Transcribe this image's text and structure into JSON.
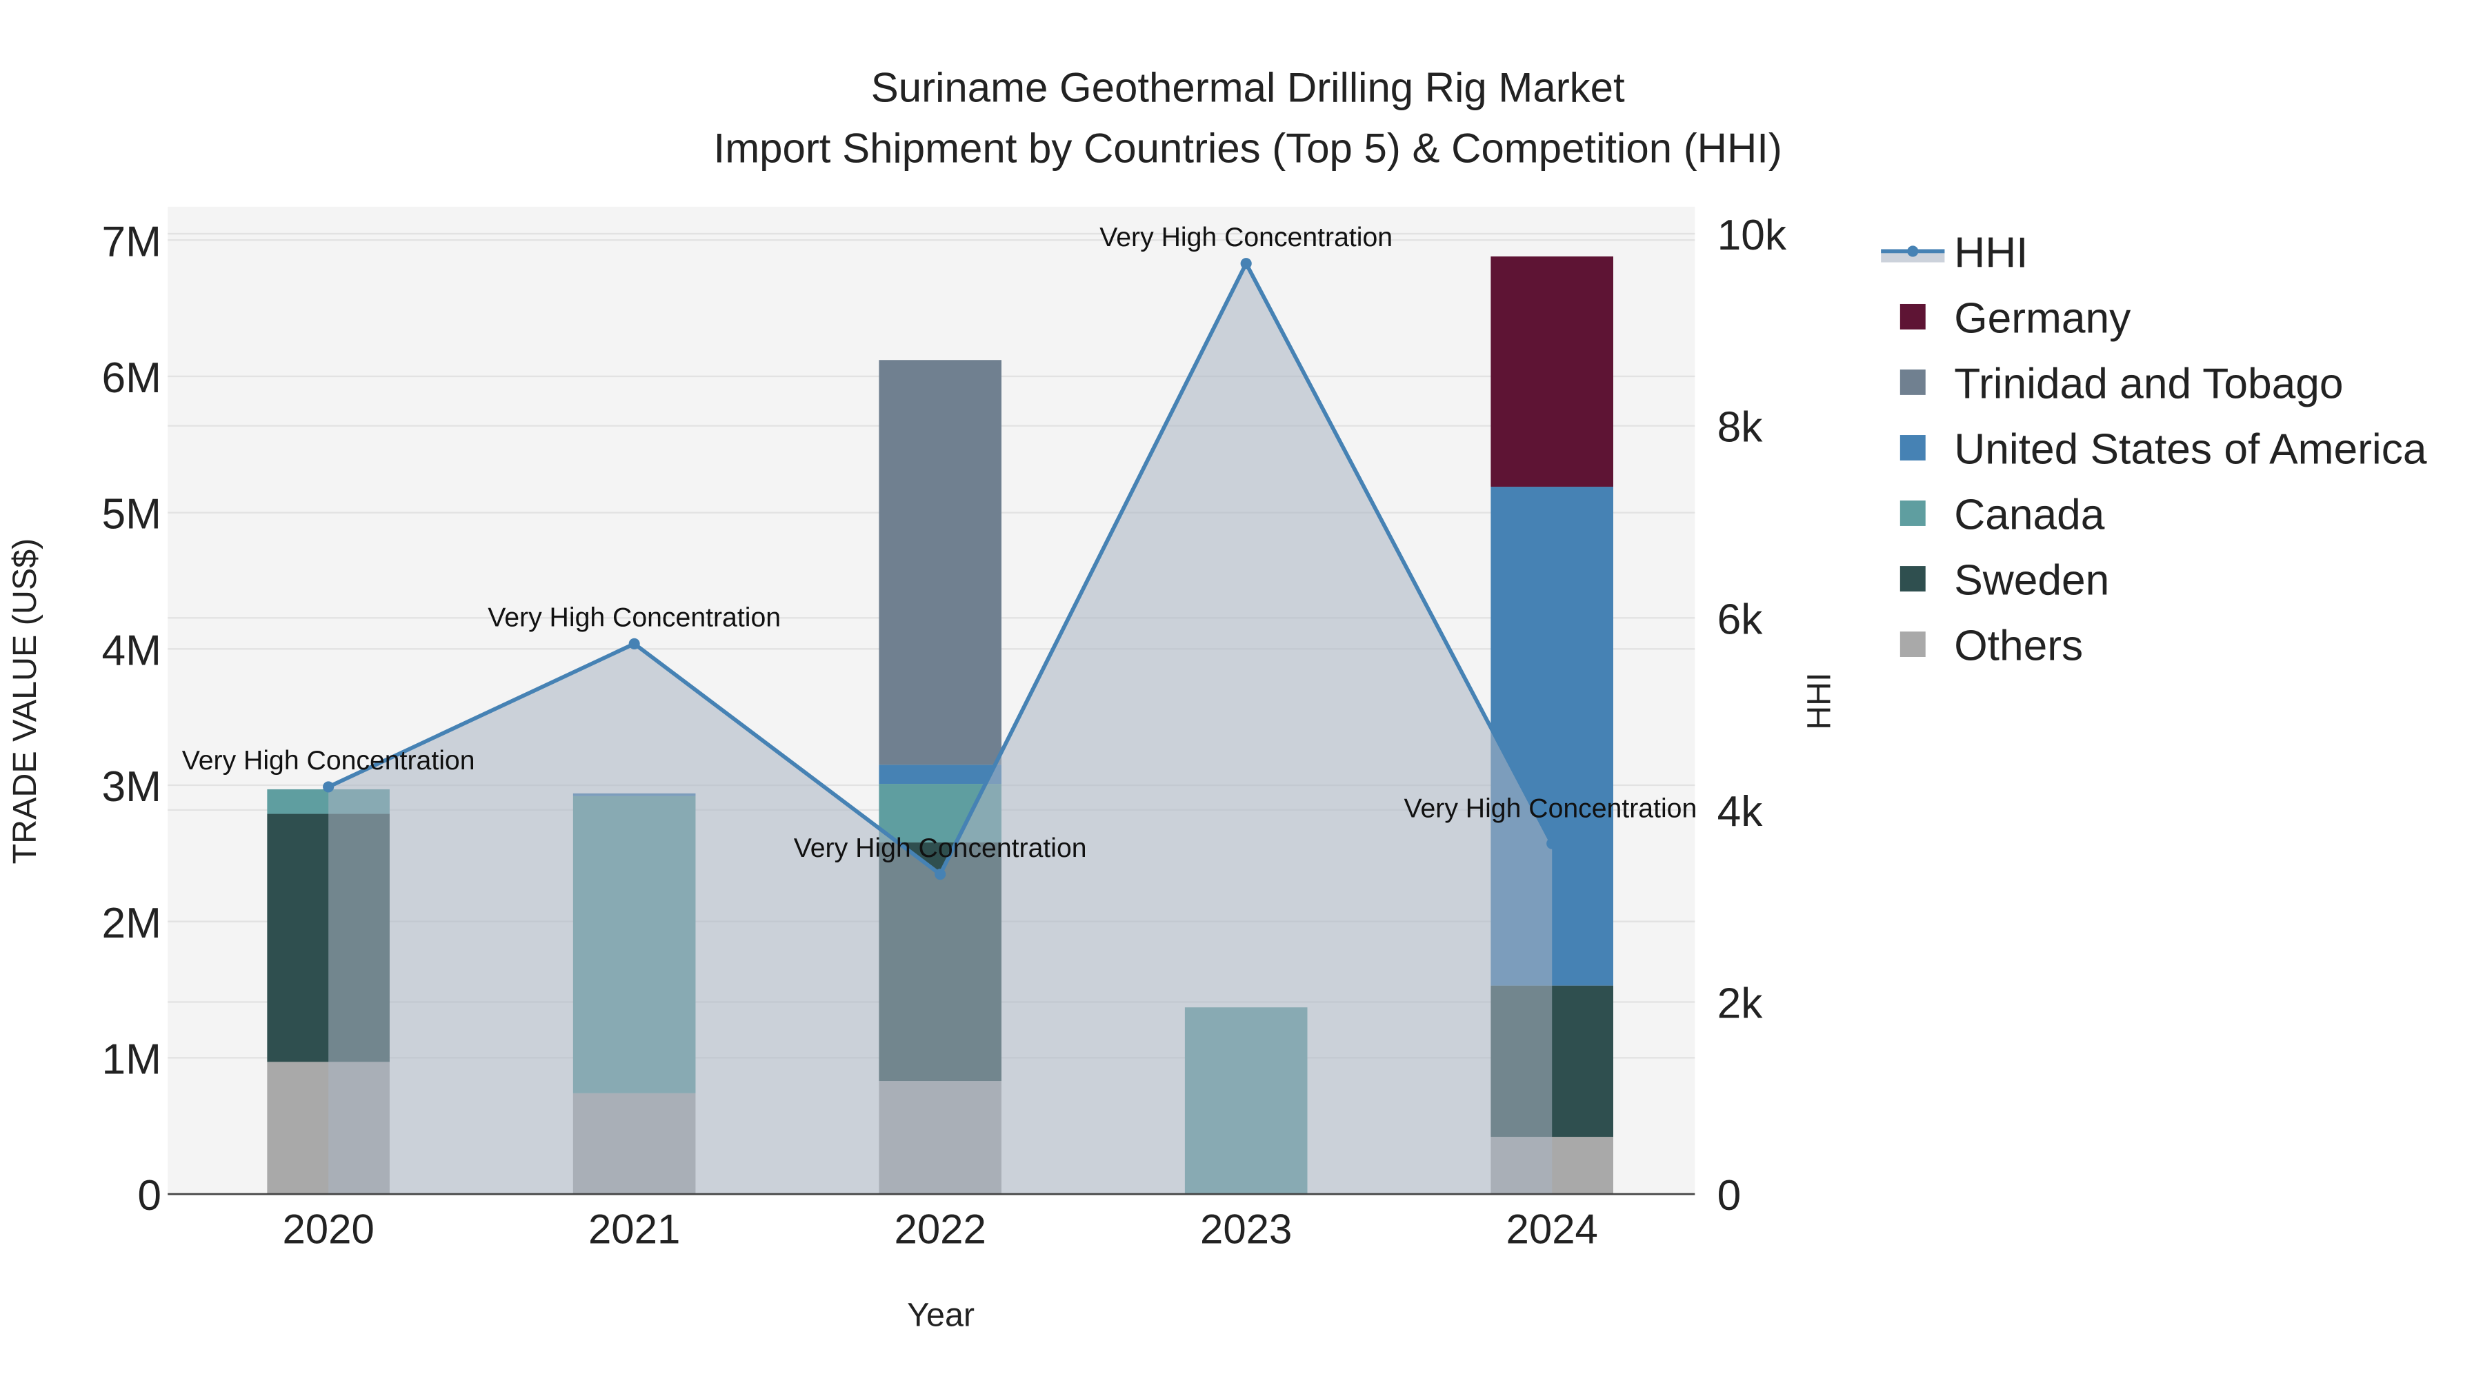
{
  "chart_data": {
    "type": "bar",
    "stacked": true,
    "title": "Suriname Geothermal Drilling Rig Market",
    "subtitle": "Import Shipment by Countries (Top 5) & Competition (HHI)",
    "xlabel": "Year",
    "ylabel": "TRADE VALUE (US$)",
    "y2label": "HHI",
    "categories": [
      "2020",
      "2021",
      "2022",
      "2023",
      "2024"
    ],
    "ylim": [
      0,
      7000000
    ],
    "y2lim": [
      0,
      10000
    ],
    "yticks": [
      "0",
      "1M",
      "2M",
      "3M",
      "4M",
      "5M",
      "6M",
      "7M"
    ],
    "y2ticks": [
      "0",
      "2k",
      "4k",
      "6k",
      "8k",
      "10k"
    ],
    "grid": true,
    "legend_position": "right",
    "series": [
      {
        "name": "Others",
        "color": "#a9a9a9",
        "values": [
          970000,
          740000,
          830000,
          0,
          420000
        ]
      },
      {
        "name": "Sweden",
        "color": "#2f4f4f",
        "values": [
          1820000,
          0,
          1750000,
          0,
          1110000
        ]
      },
      {
        "name": "Canada",
        "color": "#5f9ea0",
        "values": [
          180000,
          2180000,
          430000,
          1370000,
          0
        ]
      },
      {
        "name": "United States of America",
        "color": "#4682b4",
        "values": [
          0,
          20000,
          140000,
          0,
          3660000
        ]
      },
      {
        "name": "Trinidad and Tobago",
        "color": "#708090",
        "values": [
          0,
          0,
          2970000,
          0,
          0
        ]
      },
      {
        "name": "Germany",
        "color": "#5e1434",
        "values": [
          0,
          0,
          0,
          0,
          1690000
        ]
      }
    ],
    "hhi": {
      "name": "HHI",
      "color": "#4682b4",
      "values": [
        4240,
        5730,
        3330,
        9690,
        3650
      ],
      "annotations": [
        "Very High Concentration",
        "Very High Concentration",
        "Very High Concentration",
        "Very High Concentration",
        "Very High Concentration"
      ]
    },
    "legend_order": [
      "HHI",
      "Germany",
      "Trinidad and Tobago",
      "United States of America",
      "Canada",
      "Sweden",
      "Others"
    ]
  }
}
